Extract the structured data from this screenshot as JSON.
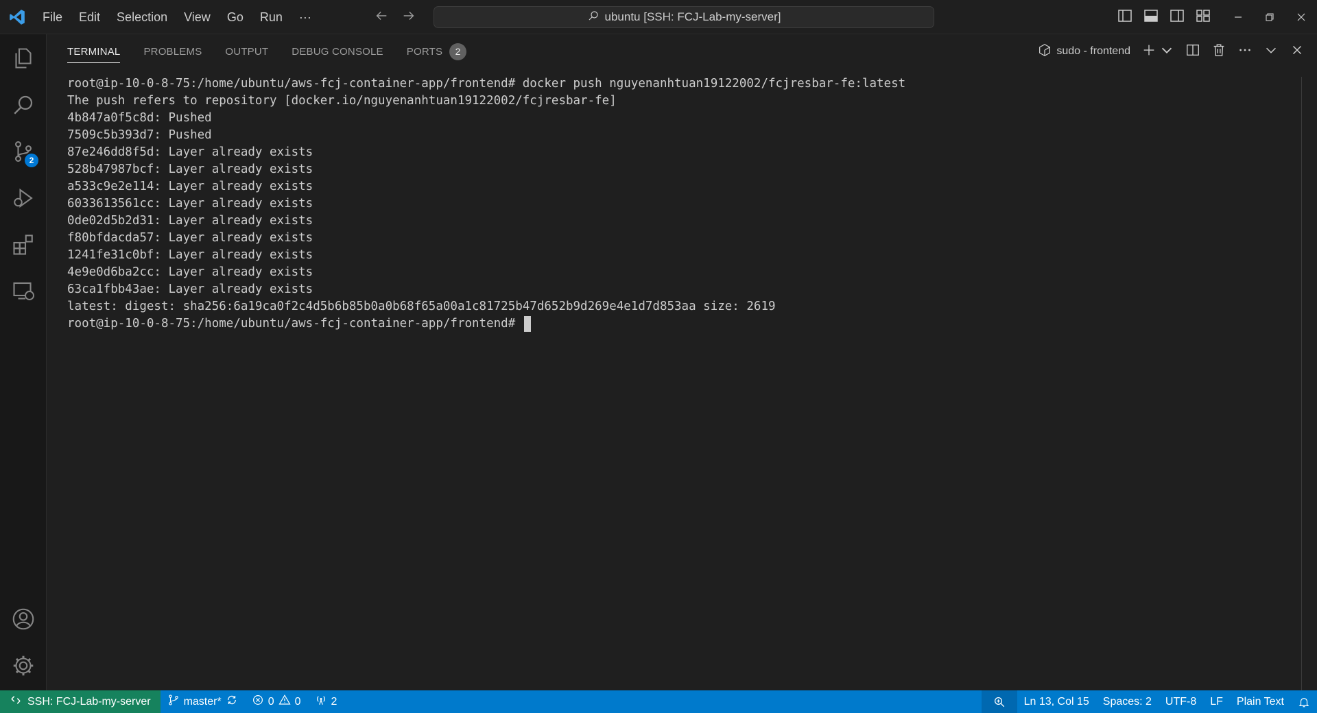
{
  "titlebar": {
    "menu": [
      "File",
      "Edit",
      "Selection",
      "View",
      "Go",
      "Run",
      "···"
    ],
    "command_center": "ubuntu [SSH: FCJ-Lab-my-server]"
  },
  "activitybar": {
    "items": [
      "explorer-icon",
      "search-icon",
      "source-control-icon",
      "run-debug-icon",
      "extensions-icon",
      "remote-explorer-icon"
    ],
    "source_control_badge": "2",
    "bottom": [
      "account-icon",
      "gear-icon"
    ]
  },
  "panel": {
    "tabs": [
      {
        "label": "TERMINAL",
        "active": true
      },
      {
        "label": "PROBLEMS"
      },
      {
        "label": "OUTPUT"
      },
      {
        "label": "DEBUG CONSOLE"
      },
      {
        "label": "PORTS",
        "badge": "2"
      }
    ],
    "terminal_name": "sudo - frontend"
  },
  "terminal": {
    "lines": [
      "root@ip-10-0-8-75:/home/ubuntu/aws-fcj-container-app/frontend# docker push nguyenanhtuan19122002/fcjresbar-fe:latest",
      "The push refers to repository [docker.io/nguyenanhtuan19122002/fcjresbar-fe]",
      "4b847a0f5c8d: Pushed",
      "7509c5b393d7: Pushed",
      "87e246dd8f5d: Layer already exists",
      "528b47987bcf: Layer already exists",
      "a533c9e2e114: Layer already exists",
      "6033613561cc: Layer already exists",
      "0de02d5b2d31: Layer already exists",
      "f80bfdacda57: Layer already exists",
      "1241fe31c0bf: Layer already exists",
      "4e9e0d6ba2cc: Layer already exists",
      "63ca1fbb43ae: Layer already exists",
      "latest: digest: sha256:6a19ca0f2c4d5b6b85b0a0b68f65a00a1c81725b47d652b9d269e4e1d7d853aa size: 2619"
    ],
    "prompt": "root@ip-10-0-8-75:/home/ubuntu/aws-fcj-container-app/frontend# "
  },
  "statusbar": {
    "remote": "SSH: FCJ-Lab-my-server",
    "branch": "master*",
    "errors": "0",
    "warnings": "0",
    "ports": "2",
    "position": "Ln 13, Col 15",
    "spaces": "Spaces: 2",
    "encoding": "UTF-8",
    "eol": "LF",
    "language": "Plain Text"
  },
  "colors": {
    "statusbar": "#007acc",
    "remote": "#16825d",
    "badge": "#0078d4"
  }
}
